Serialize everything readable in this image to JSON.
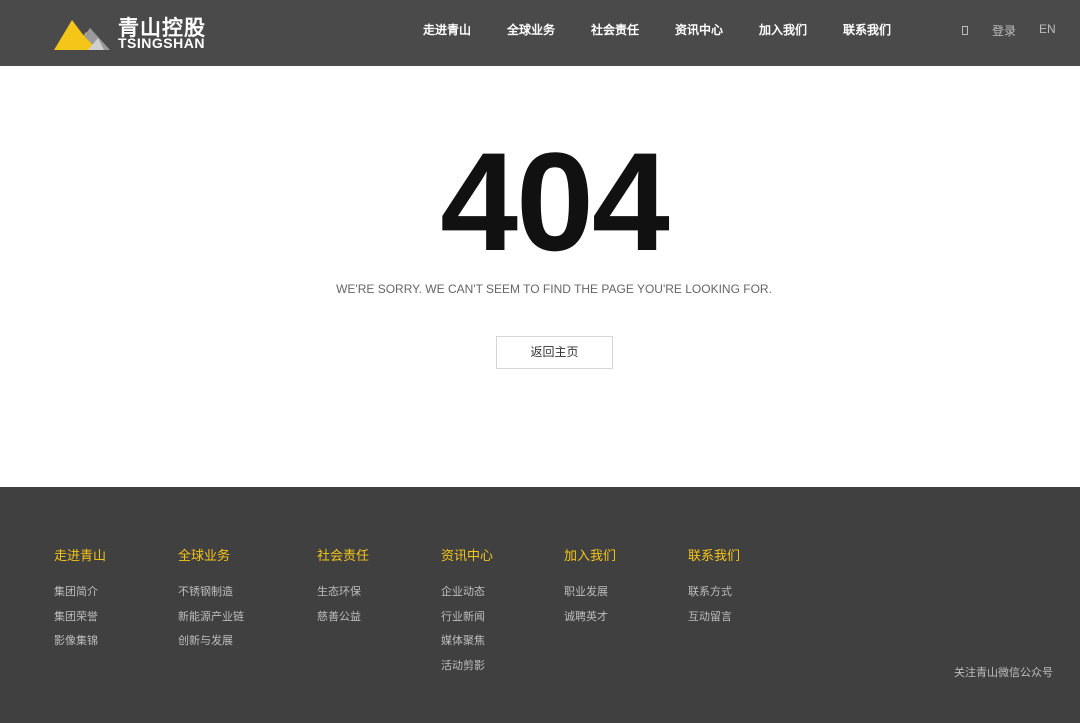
{
  "header": {
    "logo": {
      "cn": "青山控股",
      "en": "TSINGSHAN",
      "icon": "mountain-logo-icon",
      "colors": {
        "yellow": "#f5c518",
        "gray": "#9a9a9a"
      }
    },
    "nav": [
      {
        "label": "走进青山"
      },
      {
        "label": "全球业务"
      },
      {
        "label": "社会责任"
      },
      {
        "label": "资讯中心"
      },
      {
        "label": "加入我们"
      },
      {
        "label": "联系我们"
      }
    ],
    "utility": {
      "box_glyph": "",
      "login": "登录",
      "lang": "EN"
    }
  },
  "main": {
    "code": "404",
    "message": "WE'RE SORRY. WE CAN'T SEEM TO FIND THE PAGE YOU'RE LOOKING FOR.",
    "home_button": "返回主页"
  },
  "footer": {
    "columns": [
      {
        "title": "走进青山",
        "items": [
          "集团简介",
          "集团荣誉",
          "影像集锦"
        ]
      },
      {
        "title": "全球业务",
        "items": [
          "不锈钢制造",
          "新能源产业链",
          "创新与发展"
        ]
      },
      {
        "title": "社会责任",
        "items": [
          "生态环保",
          "慈善公益"
        ]
      },
      {
        "title": "资讯中心",
        "items": [
          "企业动态",
          "行业新闻",
          "媒体聚焦",
          "活动剪影"
        ]
      },
      {
        "title": "加入我们",
        "items": [
          "职业发展",
          "诚聘英才"
        ]
      },
      {
        "title": "联系我们",
        "items": [
          "联系方式",
          "互动留言"
        ]
      }
    ],
    "wechat_text": "关注青山微信公众号"
  },
  "colors": {
    "header_bg": "#4a4a4a",
    "footer_bg": "#404040",
    "accent": "#f5c518"
  }
}
